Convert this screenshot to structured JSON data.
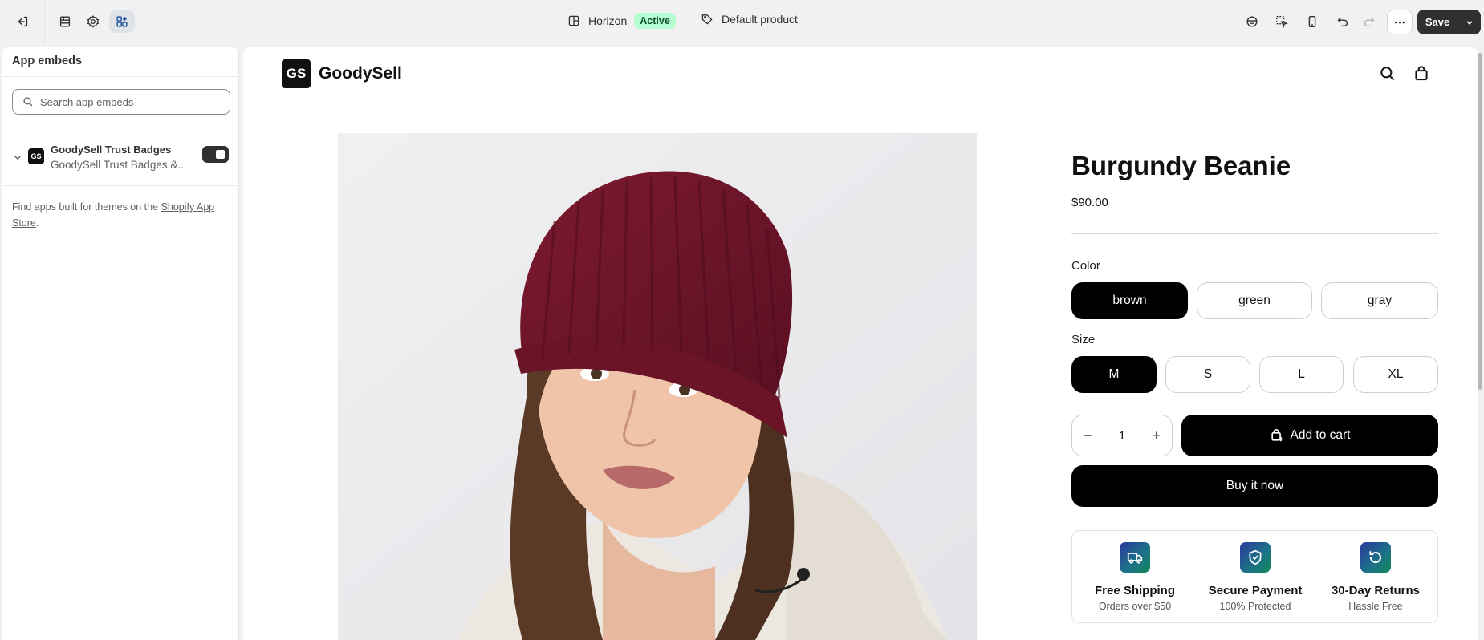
{
  "topbar": {
    "theme_name": "Horizon",
    "theme_status": "Active",
    "template": "Default product",
    "save_label": "Save"
  },
  "sidebar": {
    "title": "App embeds",
    "search_placeholder": "Search app embeds",
    "embed": {
      "logo": "GS",
      "name": "GoodySell Trust Badges",
      "subtitle": "GoodySell Trust Badges &...",
      "enabled": true
    },
    "find_text": "Find apps built for themes on the ",
    "find_link": "Shopify App Store",
    "find_suffix": "."
  },
  "store": {
    "logo": "GS",
    "name": "GoodySell"
  },
  "product": {
    "title": "Burgundy Beanie",
    "price": "$90.00",
    "color_label": "Color",
    "colors": [
      "brown",
      "green",
      "gray"
    ],
    "selected_color": "brown",
    "size_label": "Size",
    "sizes": [
      "M",
      "S",
      "L",
      "XL"
    ],
    "selected_size": "M",
    "quantity": "1",
    "minus": "−",
    "plus": "+",
    "add_to_cart": "Add to cart",
    "buy_now": "Buy it now"
  },
  "trust_badges": [
    {
      "title": "Free Shipping",
      "subtitle": "Orders over $50",
      "icon": "truck-icon"
    },
    {
      "title": "Secure Payment",
      "subtitle": "100% Protected",
      "icon": "shield-icon"
    },
    {
      "title": "30-Day Returns",
      "subtitle": "Hassle Free",
      "icon": "return-icon"
    }
  ],
  "colors": {
    "accent_active_bg": "#b4fed2",
    "primary_button": "#000000",
    "save_button": "#303030",
    "beanie": "#6e1226"
  }
}
